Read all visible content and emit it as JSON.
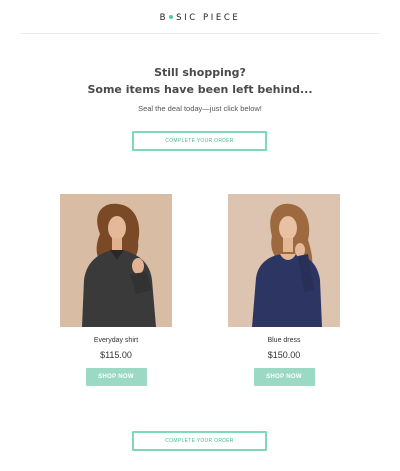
{
  "brand": {
    "before_dot": "B",
    "after_dot": "SIC PIECE"
  },
  "headline": {
    "line1": "Still shopping?",
    "line2": "Some items have been left behind...",
    "subtext": "Seal the deal today—just click below!"
  },
  "cta": {
    "label": "COMPLETE YOUR ORDER"
  },
  "products": [
    {
      "name": "Everyday shirt",
      "price": "$115.00",
      "button": "SHOP NOW",
      "image_icon": "woman-dark-shirt-photo"
    },
    {
      "name": "Blue dress",
      "price": "$150.00",
      "button": "SHOP NOW",
      "image_icon": "woman-blue-dress-photo"
    }
  ],
  "colors": {
    "accent": "#55c9a6",
    "cta_border": "#7ed9bb",
    "shop_button": "#9bd9c5",
    "photo_background": "#d9bfa8"
  }
}
